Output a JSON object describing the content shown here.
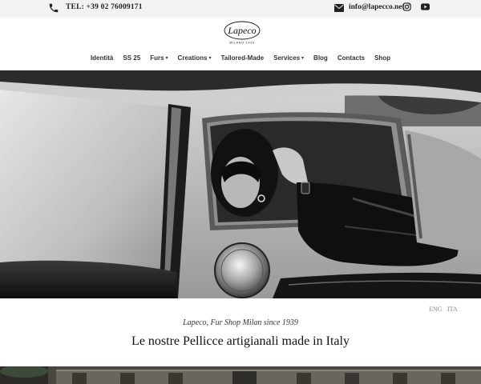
{
  "topbar": {
    "phone_icon": "phone-icon",
    "phone": "TEL: +39 02 76009171",
    "mail_icon": "envelope-icon",
    "email": "info@lapecco.net",
    "social": [
      "instagram-icon",
      "youtube-icon"
    ]
  },
  "header": {
    "logo_text": "Lapeco",
    "logo_subtext": "MILANO 1939"
  },
  "nav": {
    "items": [
      {
        "label": "Identità",
        "dropdown": false
      },
      {
        "label": "SS 25",
        "dropdown": false
      },
      {
        "label": "Furs",
        "dropdown": true
      },
      {
        "label": "Creations",
        "dropdown": true
      },
      {
        "label": "Tailored-Made",
        "dropdown": false
      },
      {
        "label": "Services",
        "dropdown": true
      },
      {
        "label": "Blog",
        "dropdown": false
      },
      {
        "label": "Contacts",
        "dropdown": false
      },
      {
        "label": "Shop",
        "dropdown": false
      }
    ],
    "chevron": "▾"
  },
  "language": {
    "eng": "ENG",
    "ita": "ITA"
  },
  "intro": {
    "tagline": "Lapeco, Fur Shop Milan since 1939",
    "headline": "Le nostre Pellicce artigianali made in Italy"
  },
  "colors": {
    "topbar_bg": "#f2f2f2",
    "text": "#222222",
    "muted": "#888888"
  }
}
